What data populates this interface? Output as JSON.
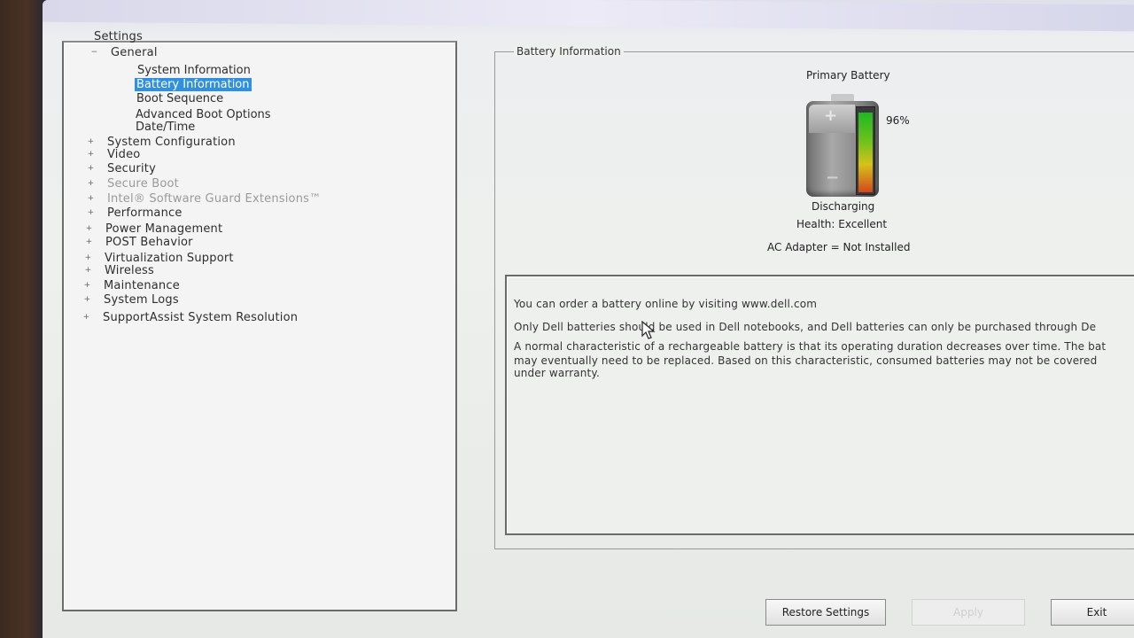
{
  "tree": {
    "title": "Settings",
    "nodes": [
      {
        "label": "General",
        "expander": "−",
        "children": [
          {
            "label": "System Information"
          },
          {
            "label": "Battery Information",
            "selected": true
          },
          {
            "label": "Boot Sequence"
          },
          {
            "label": "Advanced Boot Options"
          },
          {
            "label": "Date/Time"
          }
        ]
      },
      {
        "label": "System Configuration",
        "expander": "+"
      },
      {
        "label": "Video",
        "expander": "+"
      },
      {
        "label": "Security",
        "expander": "+"
      },
      {
        "label": "Secure Boot",
        "expander": "+"
      },
      {
        "label": "Intel® Software Guard Extensions™",
        "expander": "+"
      },
      {
        "label": "Performance",
        "expander": "+"
      },
      {
        "label": "Power Management",
        "expander": "+"
      },
      {
        "label": "POST Behavior",
        "expander": "+"
      },
      {
        "label": "Virtualization Support",
        "expander": "+"
      },
      {
        "label": "Wireless",
        "expander": "+"
      },
      {
        "label": "Maintenance",
        "expander": "+"
      },
      {
        "label": "System Logs",
        "expander": "+"
      },
      {
        "label": "SupportAssist System Resolution",
        "expander": "+"
      }
    ]
  },
  "battery_info": {
    "group_label": "Battery Information",
    "primary_label": "Primary Battery",
    "charge_percent": 96,
    "charge_text": "96%",
    "state": "Discharging",
    "health": "Health: Excellent",
    "ac_adapter": "AC Adapter = Not Installed"
  },
  "info_text": {
    "line1": "You can order a battery online by visiting www.dell.com",
    "line2": "Only Dell batteries should be used in Dell notebooks, and Dell batteries can only be purchased through De",
    "line3": "A normal characteristic of a rechargeable battery is that its operating duration decreases over time.  The bat",
    "line4": "may eventually need to be replaced.  Based on this characteristic, consumed batteries may not be covered",
    "line5": "under warranty."
  },
  "buttons": {
    "restore": "Restore Settings",
    "apply": "Apply",
    "exit": "Exit"
  },
  "colors": {
    "selection": "#2f8fe0",
    "gauge_green": "#1fb823",
    "gauge_red": "#d4471c"
  }
}
